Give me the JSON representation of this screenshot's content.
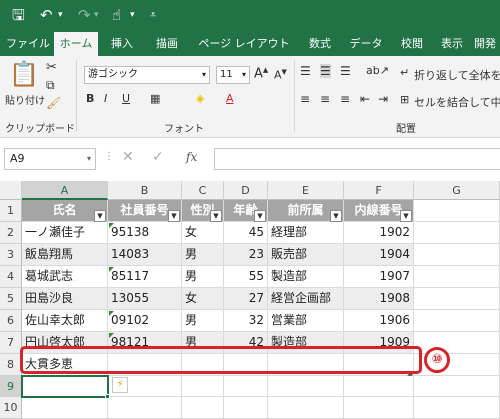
{
  "quick_access": {
    "save_icon": "save-icon",
    "undo_icon": "undo-icon",
    "redo_icon": "redo-icon",
    "touch_icon": "touch-mode-icon",
    "customize_icon": "customize-qat-icon"
  },
  "tabs": [
    {
      "label": "ファイル",
      "active": false
    },
    {
      "label": "ホーム",
      "active": true
    },
    {
      "label": "挿入",
      "active": false
    },
    {
      "label": "描画",
      "active": false
    },
    {
      "label": "ページ レイアウト",
      "active": false
    },
    {
      "label": "数式",
      "active": false
    },
    {
      "label": "データ",
      "active": false
    },
    {
      "label": "校閲",
      "active": false
    },
    {
      "label": "表示",
      "active": false
    },
    {
      "label": "開発",
      "active": false
    }
  ],
  "ribbon": {
    "paste_label": "貼り付け",
    "clipboard_group": "クリップボード",
    "font_group": "フォント",
    "align_group": "配置",
    "font_name": "游ゴシック",
    "font_size": "11",
    "wrap_text": "折り返して全体を表",
    "merge_center": "セルを結合して中央"
  },
  "formula_bar": {
    "name_box": "A9",
    "fx_label": "fx",
    "value": ""
  },
  "columns": [
    "A",
    "B",
    "C",
    "D",
    "E",
    "F",
    "G"
  ],
  "rows": [
    "1",
    "2",
    "3",
    "4",
    "5",
    "6",
    "7",
    "8",
    "9",
    "10"
  ],
  "table": {
    "headers": [
      "氏名",
      "社員番号",
      "性別",
      "年齢",
      "前所属",
      "内線番号"
    ],
    "rows": [
      [
        "一ノ瀬佳子",
        "95138",
        "女",
        "45",
        "経理部",
        "1902"
      ],
      [
        "飯島翔馬",
        "14083",
        "男",
        "23",
        "販売部",
        "1904"
      ],
      [
        "葛城武志",
        "85117",
        "男",
        "55",
        "製造部",
        "1907"
      ],
      [
        "田島沙良",
        "13055",
        "女",
        "27",
        "経営企画部",
        "1908"
      ],
      [
        "佐山幸太郎",
        "09102",
        "男",
        "32",
        "営業部",
        "1906"
      ],
      [
        "円山啓太郎",
        "98121",
        "男",
        "42",
        "製造部",
        "1909"
      ]
    ],
    "new_row_value": "大貫多恵"
  },
  "annotation": {
    "badge": "⑩"
  },
  "colors": {
    "accent": "#217346",
    "highlight": "#d8232a",
    "header_fill": "#a5a5a5",
    "band_fill": "#ededed"
  }
}
